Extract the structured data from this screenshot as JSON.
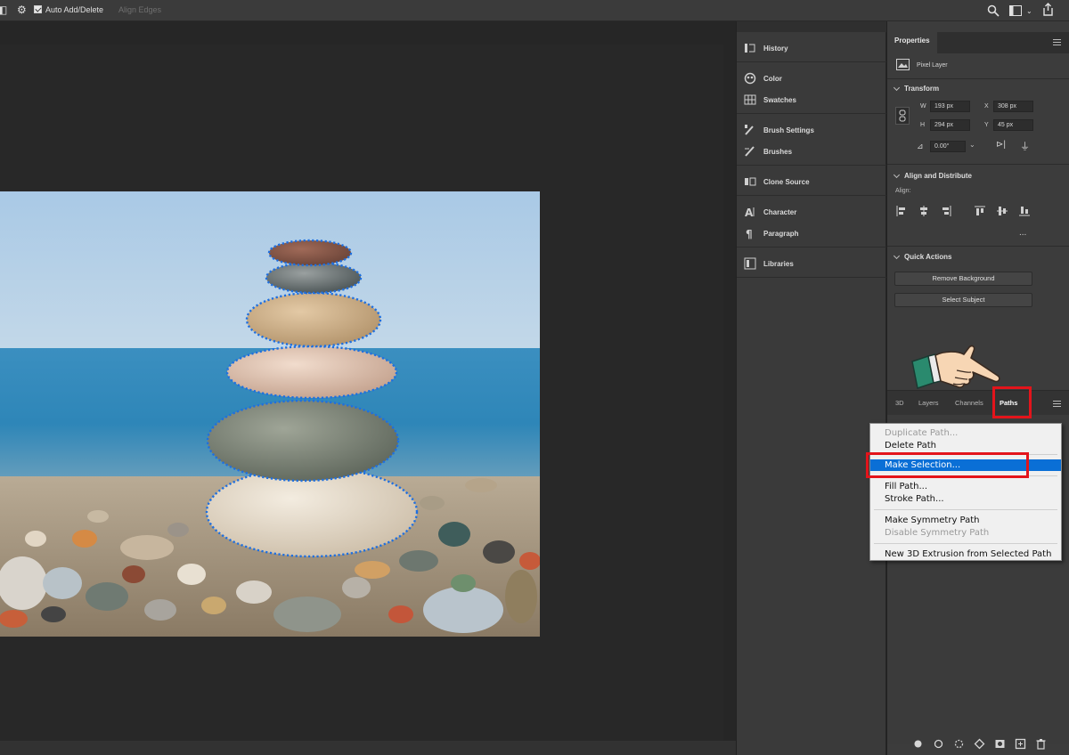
{
  "options_bar": {
    "auto_add_delete_label": "Auto Add/Delete",
    "align_edges_label": "Align Edges"
  },
  "dock": {
    "items": [
      {
        "label": "History",
        "icon": "history-icon"
      },
      {
        "label": "Color",
        "icon": "color-icon"
      },
      {
        "label": "Swatches",
        "icon": "swatches-icon"
      },
      {
        "label": "Brush Settings",
        "icon": "brush-settings-icon"
      },
      {
        "label": "Brushes",
        "icon": "brushes-icon"
      },
      {
        "label": "Clone Source",
        "icon": "clone-source-icon"
      },
      {
        "label": "Character",
        "icon": "character-icon"
      },
      {
        "label": "Paragraph",
        "icon": "paragraph-icon"
      },
      {
        "label": "Libraries",
        "icon": "libraries-icon"
      }
    ]
  },
  "properties": {
    "tab_label": "Properties",
    "layer_type": "Pixel Layer",
    "transform": {
      "title": "Transform",
      "w_label": "W",
      "w_value": "193 px",
      "h_label": "H",
      "h_value": "294 px",
      "x_label": "X",
      "x_value": "308 px",
      "y_label": "Y",
      "y_value": "45 px",
      "angle_value": "0.00°"
    },
    "align": {
      "title": "Align and Distribute",
      "align_label": "Align:",
      "more": "..."
    },
    "quick_actions": {
      "title": "Quick Actions",
      "remove_background": "Remove Background",
      "select_subject": "Select Subject"
    }
  },
  "layers_panel": {
    "tabs": [
      "3D",
      "Layers",
      "Channels",
      "Paths"
    ],
    "active_tab": "Paths"
  },
  "context_menu": {
    "items": [
      {
        "label": "Duplicate Path...",
        "disabled": true
      },
      {
        "label": "Delete Path",
        "disabled": false
      },
      {
        "label": "Make Selection...",
        "disabled": false,
        "highlighted": true
      },
      {
        "label": "Fill Path...",
        "disabled": false
      },
      {
        "label": "Stroke Path...",
        "disabled": false
      },
      {
        "label": "Make Symmetry Path",
        "disabled": false
      },
      {
        "label": "Disable Symmetry Path",
        "disabled": true
      },
      {
        "label": "New 3D Extrusion from Selected Path",
        "disabled": false
      }
    ]
  },
  "colors": {
    "highlight": "#0a6fd6",
    "annotation_red": "#e3141b",
    "selection_dots": "#1e6fe0"
  }
}
